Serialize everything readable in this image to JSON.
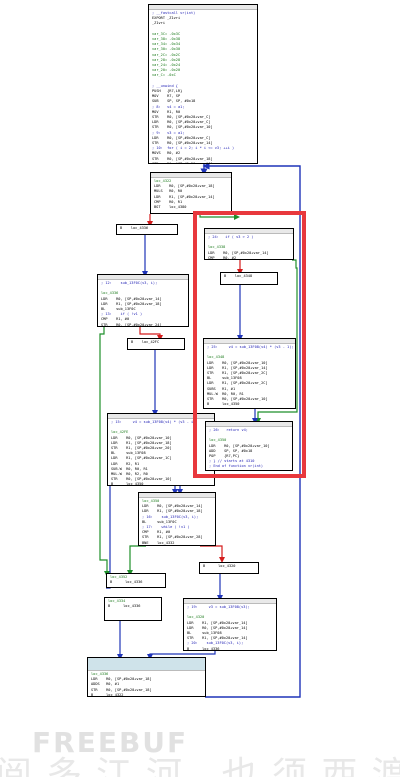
{
  "graph": {
    "blocks": {
      "entry": [
        "; __fastcall vr(int)",
        "EXPORT _Z1vri",
        "_Z1vri",
        "",
        "var_3C= -0x3C",
        "var_38= -0x38",
        "var_34= -0x34",
        "var_30= -0x30",
        "var_2C= -0x2C",
        "var_28= -0x28",
        "var_24= -0x24",
        "var_20= -0x20",
        "var_C= -0xC",
        "",
        "; __unwind {",
        "PUSH   {R7,LR}",
        "MOV    R7, SP",
        "SUB    SP, SP, #0x18",
        "; 8:   v4 = a1;",
        "MOV    R1, R0",
        "STR    R0, [SP,#0x20+var_C]",
        "LDR    R0, [SP,#0x20+var_C]",
        "STR    R0, [SP,#0x20+var_10]",
        "; 9:   v3 = a1;",
        "LDR    R0, [SP,#0x20+var_C]",
        "STR    R0, [SP,#0x20+var_14]",
        "; 10:  for ( i = 2; i * i <= v3; ++i )",
        "MOVS   R0, #2",
        "STR    R0, [SP,#0x20+var_18]",
        "STR    R1, [SP,#0x20+var_1C]",
        "B      loc_4322"
      ],
      "loop_head": [
        "loc_4322",
        "LDR    R0, [SP,#0x20+var_18]",
        "MULS   R0, R0",
        "LDR    R1, [SP,#0x20+var_14]",
        "CMP    R0, R1",
        "BGT    loc_4380"
      ],
      "b_4336": [
        "B    loc_4336"
      ],
      "sub_inner": [
        "; 12:    sub_13F0C(v3, i);",
        "",
        "loc_4336",
        "LDR    R0, [SP,#0x20+var_14]",
        "LDR    R1, [SP,#0x20+var_18]",
        "BL     sub_13F0C",
        "; 13:    if ( !v1 )",
        "CMP    R1, #0",
        "STR    R0, [SP,#0x20+var_24]",
        "BNE    loc_4336"
      ],
      "b_42fc": [
        "B    loc_42FC"
      ],
      "calc_a": [
        "; 15:     v4 = sub_13F08(v4) * (v3 - i);",
        "",
        "loc_42FE",
        "LDR    R0, [SP,#0x20+var_10]",
        "LDR    R1, [SP,#0x20+var_18]",
        "STR    R1, [SP,#0x20+var_20]",
        "BL     sub_13F08",
        "LDR    R1, [SP,#0x20+var_1C]",
        "LDR    R2, R1",
        "SUB.W  R0, R0, R1",
        "MUL.W  R0, R2, R0",
        "STR    R0, [SP,#0x20+var_10]",
        "B      loc_4350"
      ],
      "loop_tail": [
        "loc_4350",
        "LDR    R0, [SP,#0x20+var_14]",
        "LDR    R1, [SP,#0x20+var_18]",
        "; 16:    sub_13F0C(v3, i);",
        "BL     sub_13F0C",
        "; 17:    while ( !v1 )",
        "CMP    R1, #0",
        "STR    R1, [SP,#0x20+var_28]",
        "BNE    loc_4332"
      ],
      "b_4352": [
        "loc_4352",
        "B      loc_4336"
      ],
      "b_4320": [
        "B      loc_4320"
      ],
      "b_4334": [
        "loc_4334",
        "B      loc_4336"
      ],
      "calc_b": [
        "; 19:     v3 = sub_13F08(v3);",
        "",
        "loc_4320",
        "LDR    R1, [SP,#0x20+var_14]",
        "LDR    R0, [SP,#0x20+var_14]",
        "BL     sub_13F08",
        "STR    R1, [SP,#0x20+var_14]",
        "; 20:    sub_13F0C(v3, i);",
        "B      loc_4336"
      ],
      "incr": [
        "loc_4336",
        "LDR    R0, [SP,#0x20+var_18]",
        "ADDS   R0, #1",
        "STR    R0, [SP,#0x20+var_18]",
        "B      loc_4322"
      ],
      "r_if": [
        "; 24:   if ( v3 > 2 )",
        "",
        "loc_4338",
        "LDR    R0, [SP,#0x20+var_14]",
        "CMP    R0, #2",
        "BLT    loc_4350"
      ],
      "r_b4348": [
        "B    loc_4348"
      ],
      "r_calc": [
        "; 25:     v4 = sub_13F08(v4) * (v3 - 1);",
        "",
        "loc_4348",
        "LDR    R0, [SP,#0x20+var_10]",
        "LDR    R1, [SP,#0x20+var_14]",
        "STR    R1, [SP,#0x20+var_2C]",
        "BL     sub_13F08",
        "LDR    R1, [SP,#0x20+var_2C]",
        "SUBS   R1, #1",
        "MUL.W  R0, R0, R1",
        "STR    R0, [SP,#0x20+var_10]",
        "B      loc_4350"
      ],
      "r_ret": [
        "; 26:   return v4;",
        "",
        "loc_4350",
        "LDR    R0, [SP,#0x20+var_10]",
        "ADD    SP, SP, #0x18",
        "POP    {R7,PC}",
        "; } // starts at 4310",
        "; End of function vr(int)"
      ]
    }
  },
  "watermark": {
    "logo": "FREEBUF",
    "caption": "阅多江河 也须西渡"
  },
  "colors": {
    "edge_true": "#1e8f2a",
    "edge_false": "#d41c1c",
    "edge_uncond": "#1f34b8",
    "highlight": "#e8383d"
  }
}
